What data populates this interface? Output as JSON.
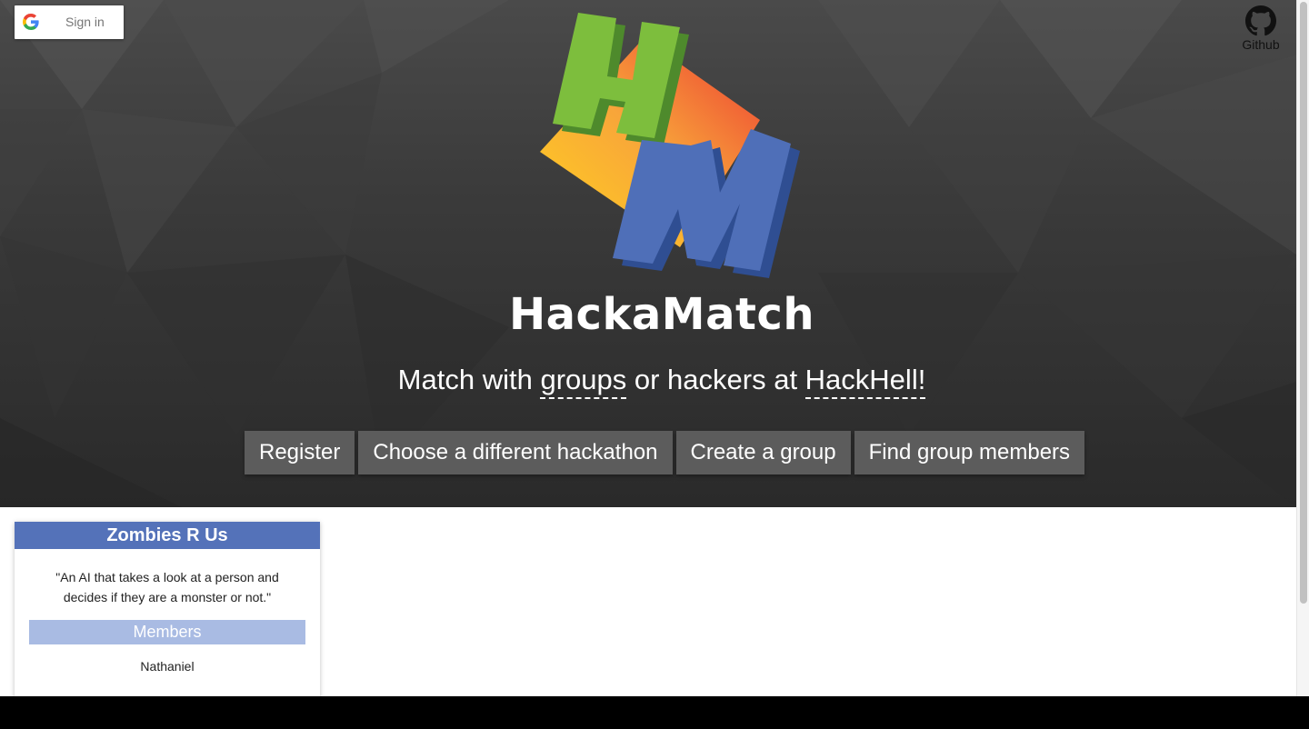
{
  "header": {
    "signin_label": "Sign in",
    "github_label": "Github"
  },
  "hero": {
    "title": "HackaMatch",
    "tagline": {
      "part1": "Match with ",
      "link1": "groups",
      "part2": " or hackers at ",
      "link2": "HackHell!"
    }
  },
  "nav": {
    "buttons": [
      {
        "label": "Register"
      },
      {
        "label": "Choose a different hackathon"
      },
      {
        "label": "Create a group"
      },
      {
        "label": "Find group members"
      }
    ]
  },
  "group_card": {
    "name": "Zombies R Us",
    "description": "\"An AI that takes a look at a person and decides if they are a monster or not.\"",
    "members_heading": "Members",
    "members": [
      "Nathaniel"
    ]
  },
  "colors": {
    "card_header": "#5472b9",
    "members_header": "#a9bbe3",
    "nav_button": "#5c5c5c",
    "logo_green": "#7dbe3d",
    "logo_blue": "#4f6fb8"
  },
  "icons": {
    "signin": "google-g-icon",
    "github": "github-octocat-icon",
    "logo": "hackamatch-logo"
  }
}
